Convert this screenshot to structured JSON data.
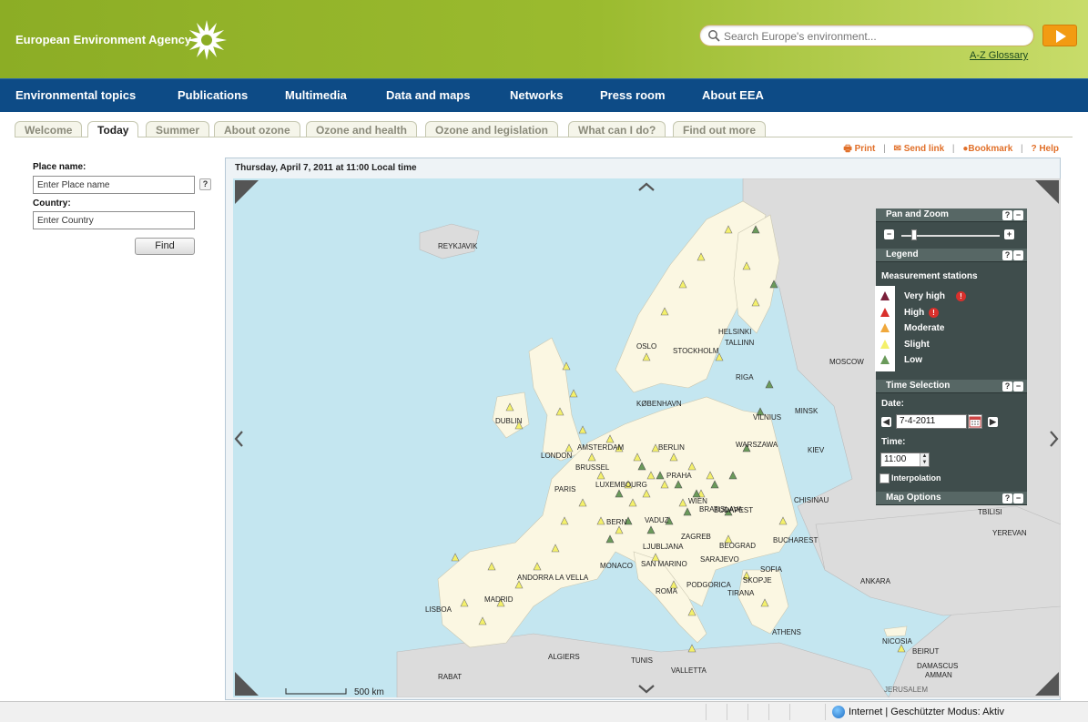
{
  "header": {
    "logo_text": "European Environment Agency",
    "search_placeholder": "Search Europe's environment...",
    "glossary_link": "A-Z Glossary"
  },
  "nav": [
    "Environmental topics",
    "Publications",
    "Multimedia",
    "Data and maps",
    "Networks",
    "Press room",
    "About EEA"
  ],
  "tabs": [
    "Welcome",
    "Today",
    "Summer",
    "About ozone",
    "Ozone and health",
    "Ozone and legislation",
    "What can I do?",
    "Find out more"
  ],
  "active_tab": "Today",
  "tools": {
    "print": "Print",
    "send_link": "Send link",
    "bookmark": "Bookmark",
    "help": "? Help"
  },
  "search_panel": {
    "place_label": "Place name:",
    "place_value": "Enter Place name",
    "help_mark": "?",
    "country_label": "Country:",
    "country_value": "Enter Country",
    "find_button": "Find"
  },
  "map": {
    "datetime": "Thursday, April 7, 2011 at 11:00 Local time",
    "scale_label": "500 km",
    "cities": [
      "REYKJAVIK",
      "OSLO",
      "STOCKHOLM",
      "HELSINKI",
      "TALLINN",
      "RIGA",
      "MOSCOW",
      "KØBENHAVN",
      "VILNIUS",
      "MINSK",
      "DUBLIN",
      "AMSTERDAM",
      "BERLIN",
      "WARSZAWA",
      "KIEV",
      "LONDON",
      "BRUSSEL",
      "PRAHA",
      "PARIS",
      "LUXEMBOURG",
      "WIEN",
      "BRATISLAVA",
      "BUDAPEST",
      "CHISINAU",
      "BERN",
      "VADUZ",
      "LJUBLJANA",
      "ZAGREB",
      "BEOGRAD",
      "BUCHAREST",
      "SARAJEVO",
      "SOFIA",
      "MONACO",
      "SAN MARINO",
      "SKOPJE",
      "PODGORICA",
      "TIRANA",
      "ANDORRA LA VELLA",
      "MADRID",
      "ROMA",
      "ANKARA",
      "LISBOA",
      "ATHENS",
      "YEREVAN",
      "TBILISI",
      "ALGIERS",
      "TUNIS",
      "NICOSIA",
      "BEIRUT",
      "DAMASCUS",
      "VALLETTA",
      "AMMAN",
      "RABAT",
      "JERUSALEM"
    ]
  },
  "overlay": {
    "pan_zoom_title": "Pan and Zoom",
    "legend_title": "Legend",
    "legend_subtitle": "Measurement stations",
    "legend_items": [
      {
        "label": "Very high",
        "color": "#7a1f3a"
      },
      {
        "label": "High",
        "color": "#d9302c"
      },
      {
        "label": "Moderate",
        "color": "#f0a83c"
      },
      {
        "label": "Slight",
        "color": "#f4f06a"
      },
      {
        "label": "Low",
        "color": "#6a9a5a"
      }
    ],
    "time_title": "Time Selection",
    "date_label": "Date:",
    "date_value": "7-4-2011",
    "time_label": "Time:",
    "time_value": "11:00",
    "interpolation_label": "Interpolation",
    "map_options_title": "Map Options"
  },
  "status_bar": {
    "text": "Internet | Geschützter Modus: Aktiv"
  }
}
